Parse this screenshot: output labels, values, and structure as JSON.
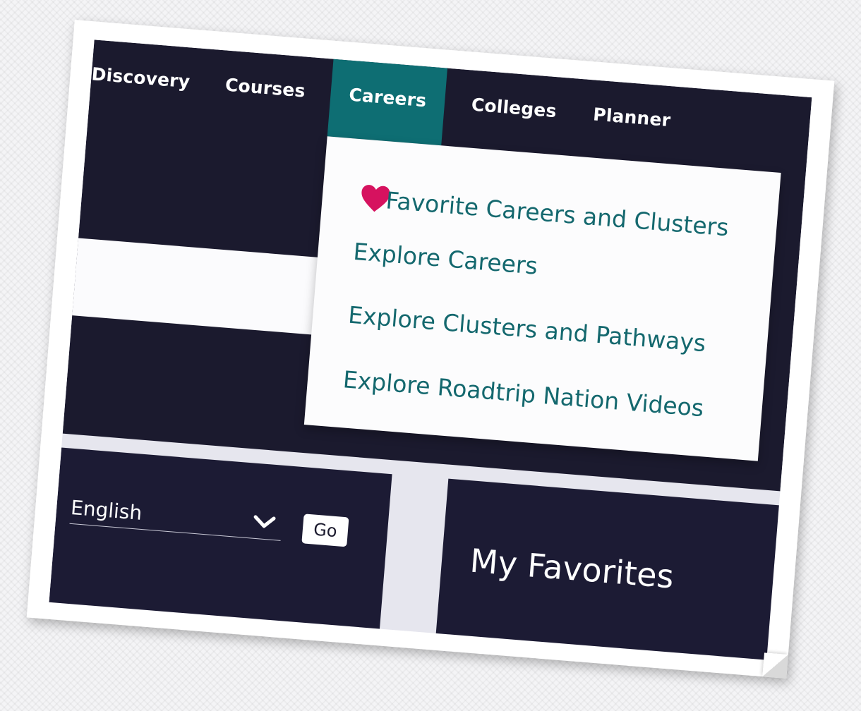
{
  "nav": {
    "items": [
      {
        "label": "Discovery"
      },
      {
        "label": "Courses"
      },
      {
        "label": "Careers",
        "active": true
      },
      {
        "label": "Colleges"
      },
      {
        "label": "Planner"
      }
    ]
  },
  "careers_menu": {
    "items": [
      {
        "label": "Favorite Careers and Clusters",
        "icon": "heart-icon"
      },
      {
        "label": "Explore Careers"
      },
      {
        "label": "Explore Clusters and Pathways"
      },
      {
        "label": "Explore Roadtrip Nation Videos"
      }
    ]
  },
  "language": {
    "selected": "English",
    "go_label": "Go"
  },
  "favorites": {
    "title": "My Favorites"
  },
  "colors": {
    "nav_bg": "#1b1a2e",
    "active_tab": "#0e6e73",
    "menu_link": "#14686e",
    "heart": "#d6125f",
    "favorites_underline": "#6c5ce7"
  }
}
